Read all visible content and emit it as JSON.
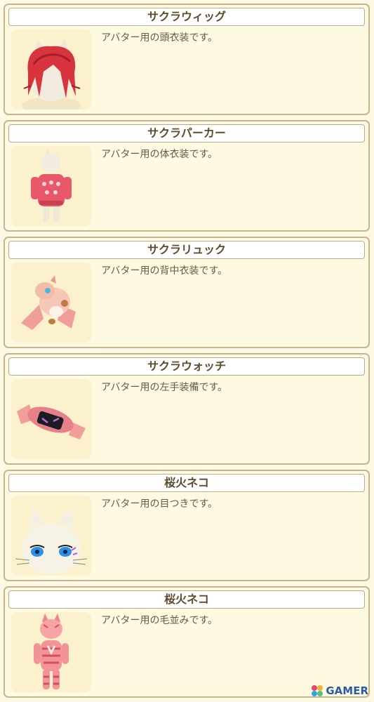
{
  "items": [
    {
      "title": "サクラウィッグ",
      "description": "アバター用の頭衣装です。",
      "icon": "pink-wig-icon"
    },
    {
      "title": "サクラパーカー",
      "description": "アバター用の体衣装です。",
      "icon": "pink-hoodie-icon"
    },
    {
      "title": "サクラリュック",
      "description": "アバター用の背中衣装です。",
      "icon": "dragon-backpack-icon"
    },
    {
      "title": "サクラウォッチ",
      "description": "アバター用の左手装備です。",
      "icon": "wristwatch-icon"
    },
    {
      "title": "桜火ネコ",
      "description": "アバター用の目つきです。",
      "icon": "cat-eyes-icon"
    },
    {
      "title": "桜火ネコ",
      "description": "アバター用の毛並みです。",
      "icon": "striped-cat-fur-icon"
    }
  ],
  "watermark": {
    "label": "GAMER"
  },
  "colors": {
    "background": "#fdf9e4",
    "card_border": "#c7b48a",
    "title_text": "#5e4a2e",
    "watermark": "#2e5aa6"
  }
}
